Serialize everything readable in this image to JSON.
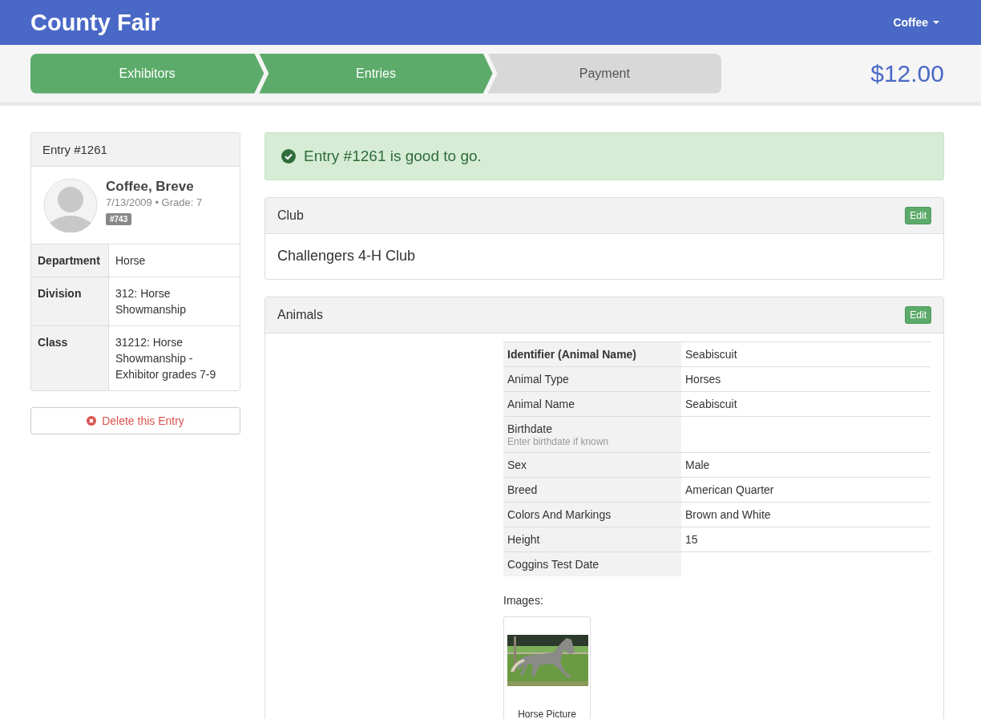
{
  "navbar": {
    "brand": "County Fair",
    "user_menu": "Coffee"
  },
  "steps": [
    {
      "label": "Exhibitors",
      "done": true
    },
    {
      "label": "Entries",
      "done": true
    },
    {
      "label": "Payment",
      "done": false
    }
  ],
  "total": "$12.00",
  "entry_card": {
    "title": "Entry #1261",
    "name": "Coffee, Breve",
    "meta": "7/13/2009 • Grade: 7",
    "badge": "#743",
    "rows": [
      {
        "label": "Department",
        "value": "Horse"
      },
      {
        "label": "Division",
        "value": "312: Horse Showmanship"
      },
      {
        "label": "Class",
        "value": "31212: Horse Showmanship - Exhibitor grades 7-9"
      }
    ]
  },
  "delete_button": "Delete this Entry",
  "alert": "Entry #1261 is good to go.",
  "club_panel": {
    "title": "Club",
    "edit": "Edit",
    "value": "Challengers 4-H Club"
  },
  "animals_panel": {
    "title": "Animals",
    "edit": "Edit",
    "rows": [
      {
        "label": "Identifier (Animal Name)",
        "value": "Seabiscuit",
        "bold": true
      },
      {
        "label": "Animal Type",
        "value": "Horses",
        "bold": false
      },
      {
        "label": "Animal Name",
        "value": "Seabiscuit",
        "bold": false
      },
      {
        "label": "Birthdate",
        "hint": "Enter birthdate if known",
        "bold": false
      },
      {
        "label": "Sex",
        "value": "Male",
        "bold": false
      },
      {
        "label": "Breed",
        "value": "American Quarter",
        "bold": false
      },
      {
        "label": "Colors And Markings",
        "value": "Brown and White",
        "bold": false
      },
      {
        "label": "Height",
        "value": "15",
        "bold": false
      },
      {
        "label": "Coggins Test Date",
        "bold": false
      }
    ],
    "images_label": "Images:",
    "images": [
      {
        "kind": "picture",
        "caption": "Horse Picture"
      }
    ]
  }
}
